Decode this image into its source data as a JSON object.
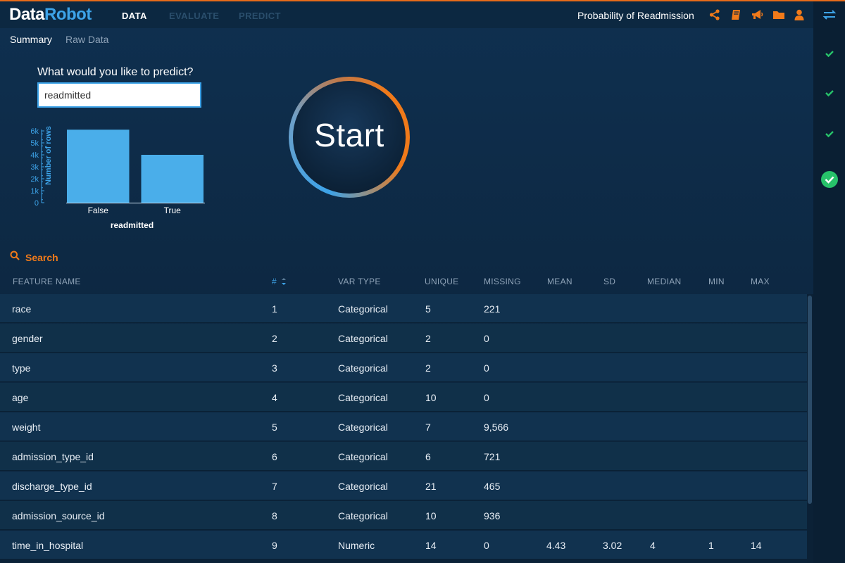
{
  "app": {
    "logo_part1": "Data",
    "logo_part2": "Robot",
    "project_title": "Probability of Readmission"
  },
  "nav": {
    "tabs": [
      {
        "label": "DATA",
        "active": true
      },
      {
        "label": "EVALUATE",
        "active": false
      },
      {
        "label": "PREDICT",
        "active": false
      }
    ]
  },
  "header_icons": [
    "share-icon",
    "book-icon",
    "megaphone-icon",
    "folder-icon",
    "user-icon"
  ],
  "sub_tabs": [
    {
      "label": "Summary",
      "active": true
    },
    {
      "label": "Raw Data",
      "active": false
    }
  ],
  "predict": {
    "question": "What would you like to predict?",
    "value": "readmitted"
  },
  "start_button": {
    "label": "Start"
  },
  "search": {
    "label": "Search"
  },
  "colors": {
    "accent_orange": "#f07a1a",
    "accent_blue": "#3da3e8",
    "bar_fill": "#4aaeea"
  },
  "chart_data": {
    "type": "bar",
    "categories": [
      "False",
      "True"
    ],
    "values": [
      6100,
      4000
    ],
    "xlabel": "readmitted",
    "ylabel": "Number of rows",
    "ylim": [
      0,
      6000
    ],
    "yticks": [
      "0",
      "1k",
      "2k",
      "3k",
      "4k",
      "5k",
      "6k"
    ]
  },
  "table": {
    "columns": [
      "FEATURE NAME",
      "#",
      "VAR TYPE",
      "UNIQUE",
      "MISSING",
      "MEAN",
      "SD",
      "MEDIAN",
      "MIN",
      "MAX"
    ],
    "rows": [
      {
        "name": " race",
        "num": "1",
        "type": "Categorical",
        "unique": "5",
        "missing": "221",
        "mean": "",
        "sd": "",
        "median": "",
        "min": "",
        "max": ""
      },
      {
        "name": "gender",
        "num": "2",
        "type": "Categorical",
        "unique": "2",
        "missing": "0",
        "mean": "",
        "sd": "",
        "median": "",
        "min": "",
        "max": ""
      },
      {
        "name": "type",
        "num": "3",
        "type": "Categorical",
        "unique": "2",
        "missing": "0",
        "mean": "",
        "sd": "",
        "median": "",
        "min": "",
        "max": ""
      },
      {
        "name": "age",
        "num": "4",
        "type": "Categorical",
        "unique": "10",
        "missing": "0",
        "mean": "",
        "sd": "",
        "median": "",
        "min": "",
        "max": ""
      },
      {
        "name": "weight",
        "num": "5",
        "type": "Categorical",
        "unique": "7",
        "missing": "9,566",
        "mean": "",
        "sd": "",
        "median": "",
        "min": "",
        "max": ""
      },
      {
        "name": "admission_type_id",
        "num": "6",
        "type": "Categorical",
        "unique": "6",
        "missing": "721",
        "mean": "",
        "sd": "",
        "median": "",
        "min": "",
        "max": ""
      },
      {
        "name": "discharge_type_id",
        "num": "7",
        "type": "Categorical",
        "unique": "21",
        "missing": "465",
        "mean": "",
        "sd": "",
        "median": "",
        "min": "",
        "max": ""
      },
      {
        "name": "admission_source_id",
        "num": "8",
        "type": "Categorical",
        "unique": "10",
        "missing": "936",
        "mean": "",
        "sd": "",
        "median": "",
        "min": "",
        "max": ""
      },
      {
        "name": "time_in_hospital",
        "num": "9",
        "type": "Numeric",
        "unique": "14",
        "missing": "0",
        "mean": "4.43",
        "sd": "3.02",
        "median": "4",
        "min": "1",
        "max": "14"
      }
    ]
  },
  "rail": {
    "items": [
      "swap-icon",
      "check-icon",
      "check-icon",
      "check-icon",
      "check-circle-icon"
    ]
  }
}
